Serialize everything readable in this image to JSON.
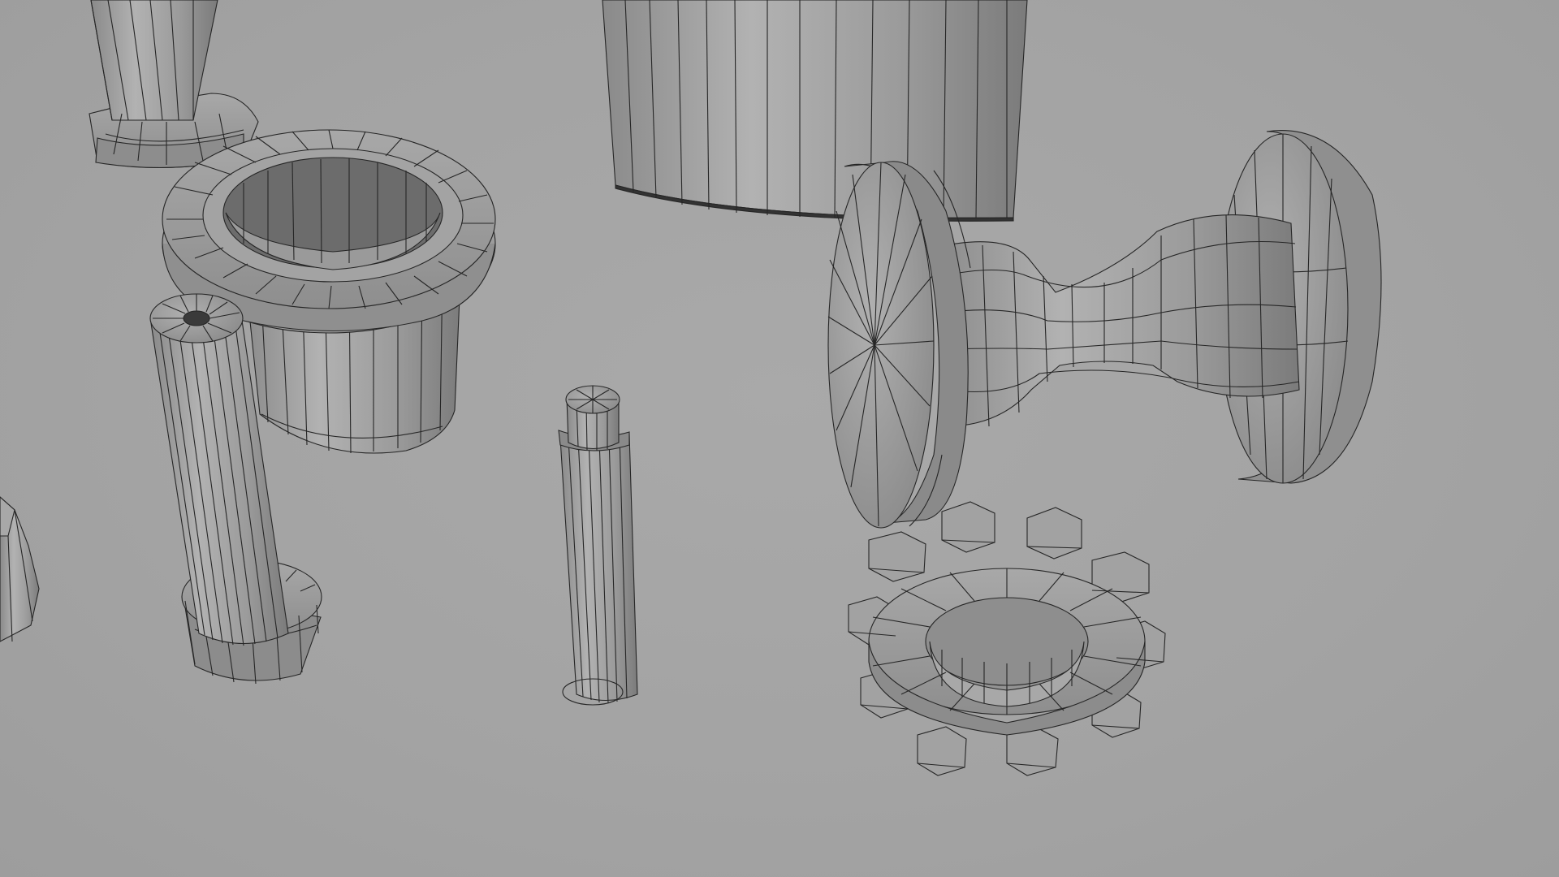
{
  "scene": {
    "background_color": "#a4a4a4",
    "mesh_fill": "#9a9a9a",
    "wire_color": "#262626",
    "objects": [
      "post-with-base-mesh",
      "tall-cylinder-mesh",
      "flanged-bushing-mesh",
      "shaft-with-foot-mesh",
      "pin-mesh",
      "spool-roller-mesh",
      "gear-ring-mesh",
      "partial-hex-mesh"
    ]
  }
}
